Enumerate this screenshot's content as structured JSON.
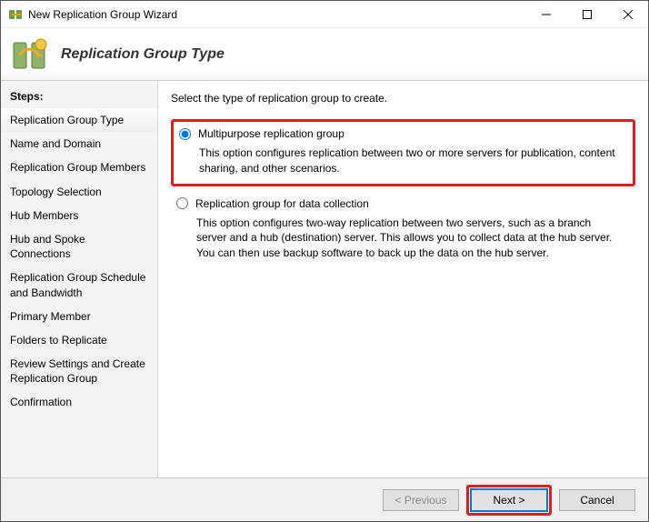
{
  "window": {
    "title": "New Replication Group Wizard"
  },
  "header": {
    "title": "Replication Group Type"
  },
  "sidebar": {
    "label": "Steps:",
    "items": [
      {
        "label": "Replication Group Type",
        "active": true
      },
      {
        "label": "Name and Domain"
      },
      {
        "label": "Replication Group Members"
      },
      {
        "label": "Topology Selection"
      },
      {
        "label": "Hub Members"
      },
      {
        "label": "Hub and Spoke Connections"
      },
      {
        "label": "Replication Group Schedule and Bandwidth"
      },
      {
        "label": "Primary Member"
      },
      {
        "label": "Folders to Replicate"
      },
      {
        "label": "Review Settings and Create Replication Group"
      },
      {
        "label": "Confirmation"
      }
    ]
  },
  "content": {
    "instruction": "Select the type of replication group to create.",
    "options": [
      {
        "label": "Multipurpose replication group",
        "description": "This option configures replication between two or more servers for publication, content sharing, and other scenarios.",
        "selected": true,
        "highlighted": true
      },
      {
        "label": "Replication group for data collection",
        "description": "This option configures two-way replication between two servers, such as a branch server and a hub (destination) server. This allows you to collect data at the hub server. You can then use backup software to back up the data on the hub server.",
        "selected": false,
        "highlighted": false
      }
    ]
  },
  "footer": {
    "previous": "< Previous",
    "next": "Next >",
    "cancel": "Cancel"
  }
}
